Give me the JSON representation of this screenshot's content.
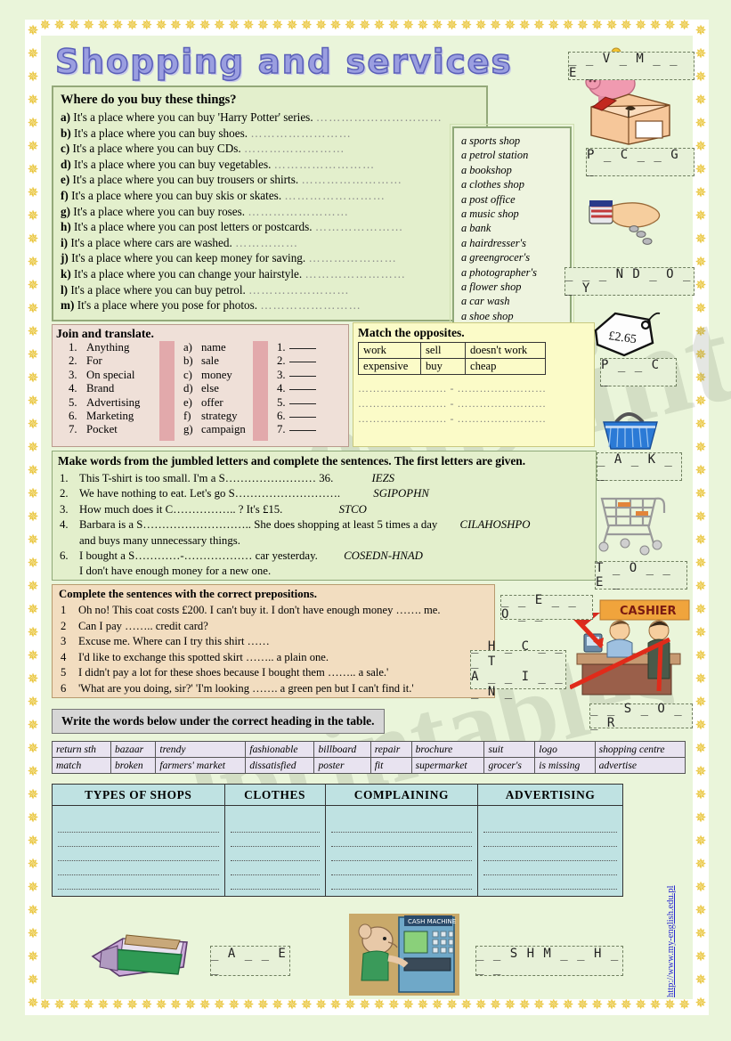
{
  "title": "Shopping and services",
  "watermark": {
    "text1": "eslprintables",
    "text2": "eslprintables",
    "url": "http://www.my-english.edu.pl"
  },
  "q1": {
    "heading": "Where do you buy these things?",
    "items": [
      {
        "letter": "a)",
        "text": "It's a place where you can buy 'Harry Potter' series.",
        "dots": "…………………………"
      },
      {
        "letter": "b)",
        "text": "It's a place where you can buy shoes.",
        "dots": "……………………"
      },
      {
        "letter": "c)",
        "text": "It's a place where you can buy CDs.",
        "dots": "……………………"
      },
      {
        "letter": "d)",
        "text": "It's a place where you can buy vegetables.",
        "dots": "……………………"
      },
      {
        "letter": "e)",
        "text": "It's a place where you can buy trousers or shirts.",
        "dots": "……………………"
      },
      {
        "letter": "f)",
        "text": "It's a place where you can buy skis or skates.",
        "dots": "……………………"
      },
      {
        "letter": "g)",
        "text": "It's a place where you can buy roses.",
        "dots": "……………………"
      },
      {
        "letter": "h)",
        "text": "It's a place where you can post letters or postcards.",
        "dots": "…………………"
      },
      {
        "letter": "i)",
        "text": "It's a place where cars are washed.",
        "dots": "……………"
      },
      {
        "letter": "j)",
        "text": "It's a place where you can keep money for saving.",
        "dots": "…………………"
      },
      {
        "letter": "k)",
        "text": "It's a place where you can change your hairstyle.",
        "dots": "……………………"
      },
      {
        "letter": "l)",
        "text": "It's a place where you can buy petrol.",
        "dots": "……………………"
      },
      {
        "letter": "m)",
        "text": "It's a place where you pose for photos.",
        "dots": "……………………"
      }
    ]
  },
  "shoplist": [
    "a sports shop",
    "a petrol station",
    "a bookshop",
    "a clothes shop",
    "a post office",
    "a music shop",
    "a bank",
    "a hairdresser's",
    "a greengrocer's",
    "a photographer's",
    "a flower shop",
    "a car wash",
    "a shoe shop"
  ],
  "q2": {
    "heading": "Join and translate.",
    "col1": [
      {
        "n": "1.",
        "w": "Anything"
      },
      {
        "n": "2.",
        "w": "For"
      },
      {
        "n": "3.",
        "w": "On special"
      },
      {
        "n": "4.",
        "w": "Brand"
      },
      {
        "n": "5.",
        "w": "Advertising"
      },
      {
        "n": "6.",
        "w": "Marketing"
      },
      {
        "n": "7.",
        "w": "Pocket"
      }
    ],
    "col2": [
      {
        "n": "a)",
        "w": "name"
      },
      {
        "n": "b)",
        "w": "sale"
      },
      {
        "n": "c)",
        "w": "money"
      },
      {
        "n": "d)",
        "w": "else"
      },
      {
        "n": "e)",
        "w": "offer"
      },
      {
        "n": "f)",
        "w": "strategy"
      },
      {
        "n": "g)",
        "w": "campaign"
      }
    ],
    "col3": [
      "1.",
      "2.",
      "3.",
      "4.",
      "5.",
      "6.",
      "7."
    ]
  },
  "q3": {
    "heading": "Match the opposites.",
    "rows": [
      [
        "work",
        "sell",
        "doesn't work"
      ],
      [
        "expensive",
        "buy",
        "cheap"
      ]
    ],
    "answer_lines": [
      "…………………… - ……………………",
      "…………………… - ……………………",
      "…………………… - ……………………"
    ]
  },
  "q4": {
    "heading": "Make words from the jumbled letters and complete the sentences. The first letters are given.",
    "items": [
      {
        "text": "This T-shirt is too small.  I'm a S…………………… 36.",
        "jumble": "IEZS"
      },
      {
        "text": "We have nothing to eat. Let's go S……………………….",
        "jumble": "SGIPOPHN"
      },
      {
        "text": "How much does it C…………….. ? It's £15.",
        "jumble": "STCO"
      },
      {
        "text": "Barbara is a S……………………….. She does shopping at least 5 times a day",
        "jumble": "CILAHOSHPO"
      },
      {
        "text": "and buys many unnecessary things.",
        "jumble": "",
        "cont": true
      },
      {
        "text": "I bought a S…………-……………… car yesterday.",
        "jumble": "COSEDN-HNAD"
      },
      {
        "text": "I don't have enough money for a new one.",
        "jumble": "",
        "cont": true
      }
    ]
  },
  "q5": {
    "heading": "Complete the sentences with the correct prepositions.",
    "items": [
      "Oh no! This coat costs £200. I can't buy it. I don't have enough money ……. me.",
      "Can I pay …….. credit card?",
      "Excuse me. Where can I try this shirt ……",
      "I'd like to exchange this spotted skirt …….. a plain one.",
      "I didn't pay a lot for these shoes because I bought them …….. a sale.'",
      "'What are you doing, sir?' 'I'm looking ……. a green pen but I can't find it.'"
    ]
  },
  "q6": {
    "heading": "Write the words below under the correct heading in the table.",
    "wordbank_row1": [
      "return sth",
      "bazaar",
      "trendy",
      "fashionable",
      "billboard",
      "repair",
      "brochure",
      "suit",
      "logo",
      "shopping centre"
    ],
    "wordbank_row2": [
      "match",
      "broken",
      "farmers' market",
      "dissatisfied",
      "poster",
      "fit",
      "supermarket",
      "grocer's",
      "is missing",
      "advertise"
    ],
    "headers": [
      "TYPES OF SHOPS",
      "CLOTHES",
      "COMPLAINING",
      "ADVERTISING"
    ]
  },
  "puzzles": {
    "save_money": "_ _ V _   M _ _ E _",
    "package": "P _   C _ _ G _",
    "spend_money": "_ _ _ N D   _ O _ _ Y",
    "price": "P _ _ C _",
    "basket": "_ A _ K _ _",
    "trolley": "T _ O _ _ E _",
    "checkout_l1": "_ H _ C _ _ _ T",
    "checkout_l2": "A _ _ I _ _ _ N _",
    "receipt": "_ _ E _ _ O _ _",
    "cashier": "_ _ S _ O _ _ R",
    "wallet": "_ A _ _ E _",
    "cash_machine": "_ _ S H   M _ _ H _ _ _"
  },
  "art": {
    "price_tag": "£2.65",
    "cashier_sign": "CASHIER",
    "atm_sign": "CASH MACHINE"
  }
}
